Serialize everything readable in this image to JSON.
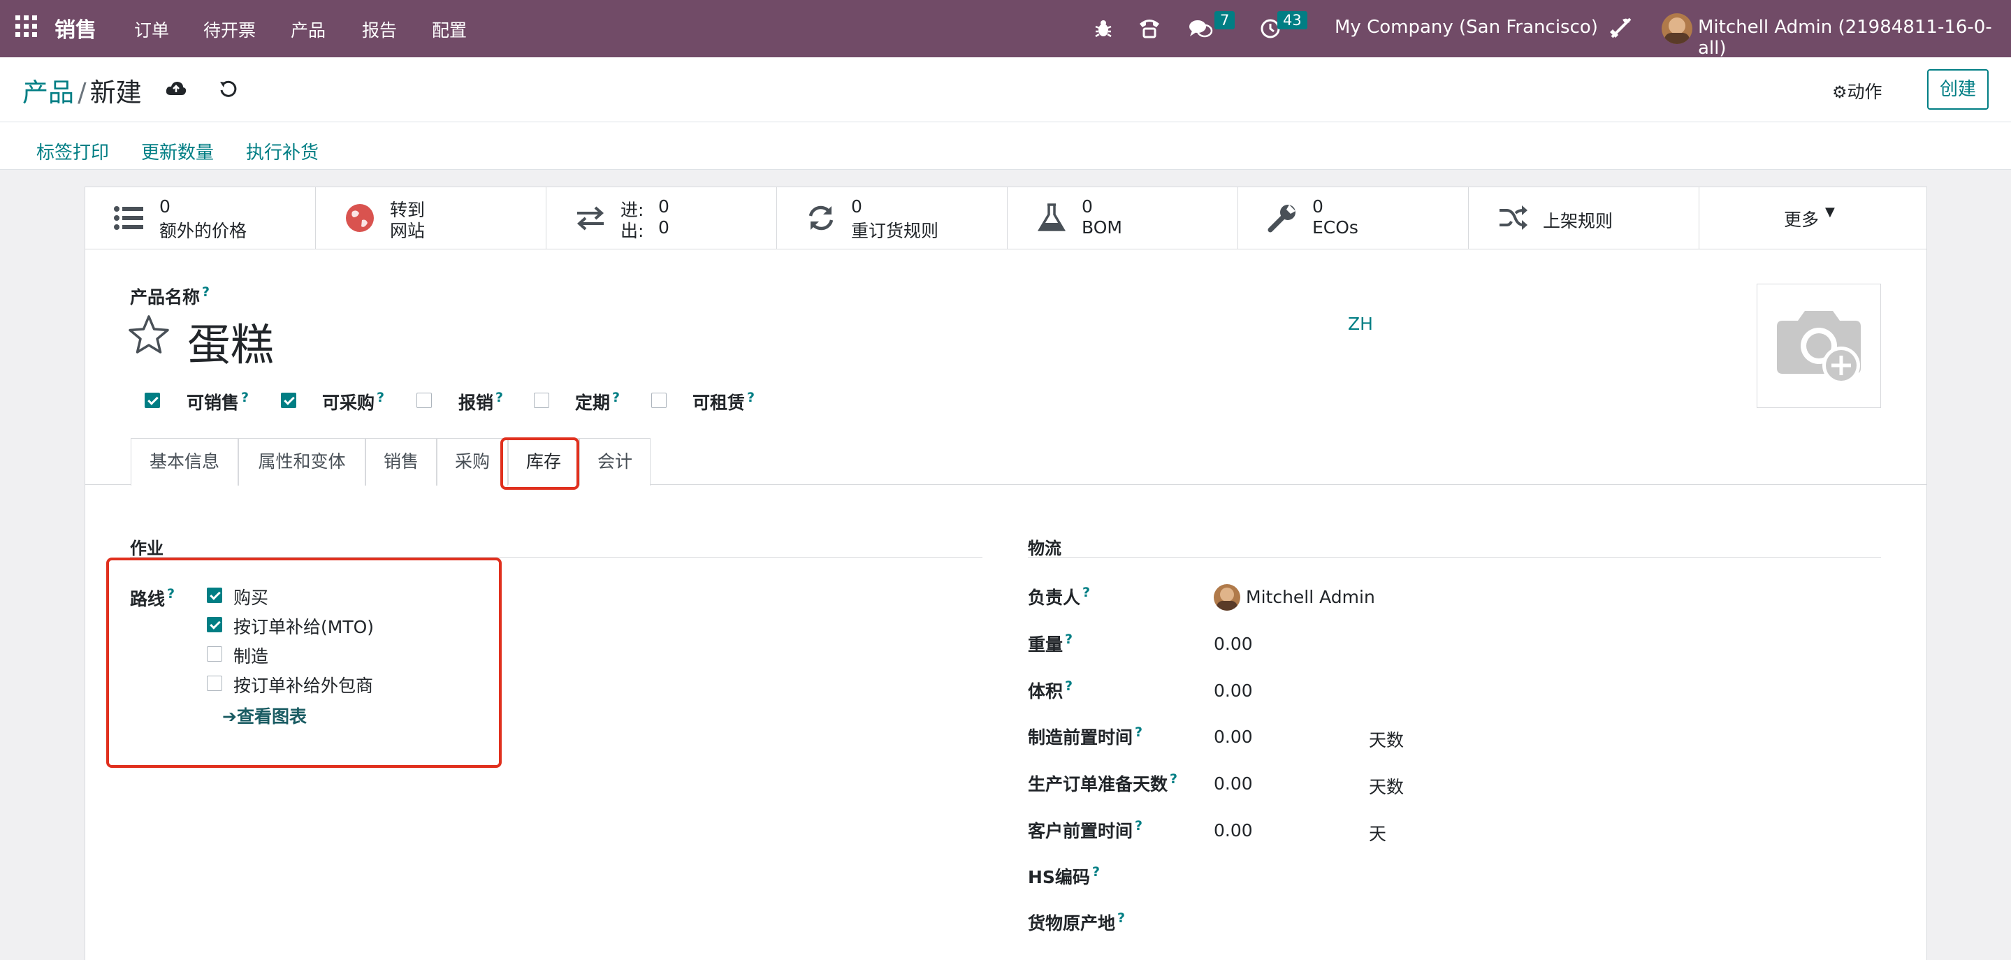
{
  "topnav": {
    "app_name": "销售",
    "menu": [
      "订单",
      "待开票",
      "产品",
      "报告",
      "配置"
    ],
    "messages_count": "7",
    "activities_count": "43",
    "company": "My Company (San Francisco)",
    "user": "Mitchell Admin (21984811-16-0-all)"
  },
  "breadcrumb": {
    "parent": "产品",
    "separator": "/",
    "current": "新建"
  },
  "actions": {
    "gear_label": "动作",
    "create_label": "创建"
  },
  "statusbar": {
    "buttons": [
      "标签打印",
      "更新数量",
      "执行补货"
    ]
  },
  "smart_buttons": {
    "extra_price": {
      "count": "0",
      "label": "额外的价格"
    },
    "website": {
      "line1": "转到",
      "line2": "网站"
    },
    "inout": {
      "in_label": "进:",
      "in_value": "0",
      "out_label": "出:",
      "out_value": "0"
    },
    "reorder": {
      "count": "0",
      "label": "重订货规则"
    },
    "bom": {
      "count": "0",
      "label": "BOM"
    },
    "ecos": {
      "count": "0",
      "label": "ECOs"
    },
    "putaway": {
      "label": "上架规则"
    },
    "more": {
      "label": "更多"
    }
  },
  "product": {
    "name_label": "产品名称",
    "name": "蛋糕",
    "lang": "ZH",
    "flags": [
      {
        "label": "可销售",
        "checked": true
      },
      {
        "label": "可采购",
        "checked": true
      },
      {
        "label": "报销",
        "checked": false
      },
      {
        "label": "定期",
        "checked": false
      },
      {
        "label": "可租赁",
        "checked": false
      }
    ]
  },
  "tabs": [
    "基本信息",
    "属性和变体",
    "销售",
    "采购",
    "库存",
    "会计"
  ],
  "active_tab": "库存",
  "operations": {
    "title": "作业",
    "routes_label": "路线",
    "routes": [
      {
        "label": "购买",
        "checked": true
      },
      {
        "label": "按订单补给(MTO)",
        "checked": true
      },
      {
        "label": "制造",
        "checked": false
      },
      {
        "label": "按订单补给外包商",
        "checked": false
      }
    ],
    "view_diagram": "查看图表"
  },
  "logistics": {
    "title": "物流",
    "responsible_label": "负责人",
    "responsible": "Mitchell Admin",
    "weight_label": "重量",
    "weight": "0.00",
    "volume_label": "体积",
    "volume": "0.00",
    "mfg_lead_label": "制造前置时间",
    "mfg_lead": "0.00",
    "mfg_lead_unit": "天数",
    "prep_days_label": "生产订单准备天数",
    "prep_days": "0.00",
    "prep_days_unit": "天数",
    "customer_lead_label": "客户前置时间",
    "customer_lead": "0.00",
    "customer_lead_unit": "天",
    "hs_label": "HS编码",
    "origin_label": "货物原产地"
  },
  "help_mark": "?",
  "colors": {
    "nav": "#714b67",
    "accent": "#017e84",
    "highlight": "#e0301e"
  }
}
